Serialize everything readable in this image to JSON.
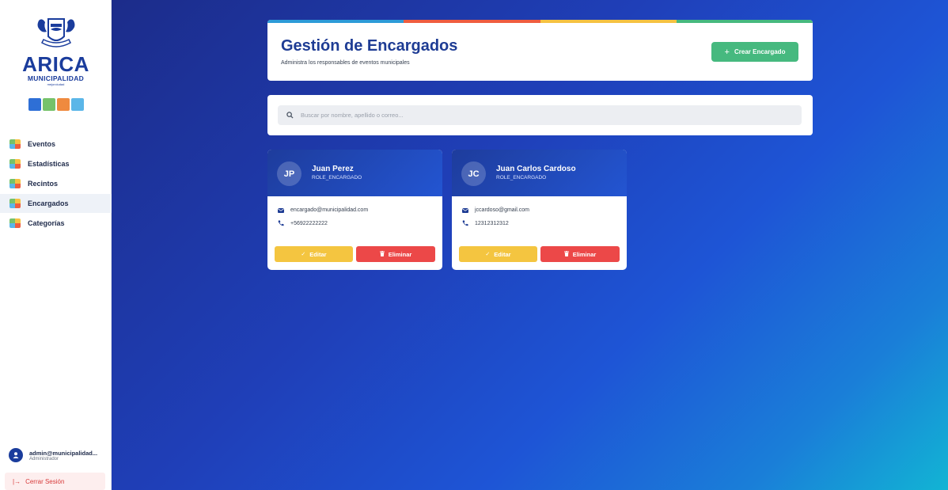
{
  "brand": {
    "title": "ARICA",
    "subtitle": "MUNICIPALIDAD",
    "tagline": "mejorciudad",
    "tile_colors": [
      "#2e6fd6",
      "#76c26a",
      "#ef8a3f",
      "#5bb6e8"
    ]
  },
  "sidebar": {
    "items": [
      {
        "label": "Eventos",
        "active": false
      },
      {
        "label": "Estadísticas",
        "active": false
      },
      {
        "label": "Recintos",
        "active": false
      },
      {
        "label": "Encargados",
        "active": true
      },
      {
        "label": "Categorías",
        "active": false
      }
    ]
  },
  "user": {
    "email": "admin@municipalidad...",
    "role": "Administrador"
  },
  "logout": {
    "icon": "logout-arrow-icon",
    "label": "Cerrar Sesión"
  },
  "header": {
    "title": "Gestión de Encargados",
    "subtitle": "Administra los responsables de eventos municipales",
    "create_button": "Crear Encargado",
    "bar_colors": [
      "#2d9bd8",
      "#ef5d3f",
      "#f5c242",
      "#46b97f"
    ]
  },
  "search": {
    "placeholder": "Buscar por nombre, apellido o correo...",
    "value": ""
  },
  "cards": [
    {
      "initials": "JP",
      "name": "Juan Perez",
      "role": "ROLE_ENCARGADO",
      "email": "encargado@municipalidad.com",
      "phone": "+56922222222",
      "edit_label": "Editar",
      "delete_label": "Eliminar"
    },
    {
      "initials": "JC",
      "name": "Juan Carlos Cardoso",
      "role": "ROLE_ENCARGADO",
      "email": "jccardoso@gmail.com",
      "phone": "12312312312",
      "edit_label": "Editar",
      "delete_label": "Eliminar"
    }
  ],
  "colors": {
    "primary": "#1e3c94",
    "success": "#46b97f",
    "warning": "#f4c540",
    "danger": "#ec4848"
  }
}
